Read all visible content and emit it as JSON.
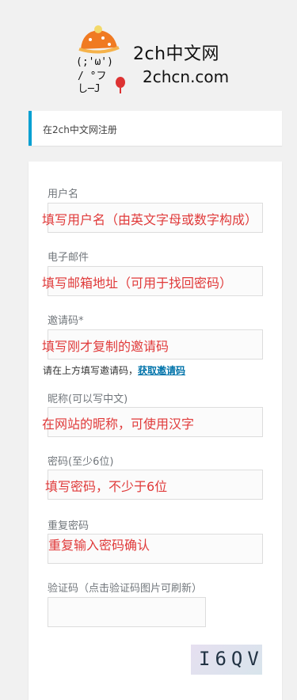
{
  "logo": {
    "title": "2ch中文网",
    "domain": "2chcn.com",
    "face_line1": "(;'ω')",
    "face_line2": "/    °フ",
    "face_line3": "し─J"
  },
  "notice": {
    "text": "在2ch中文网注册"
  },
  "form": {
    "username": {
      "label": "用户名",
      "value": "填写用户名（由英文字母或数字构成）"
    },
    "email": {
      "label": "电子邮件",
      "value": "填写邮箱地址（可用于找回密码）"
    },
    "invite": {
      "label": "邀请码*",
      "value": "填写刚才复制的邀请码",
      "hint": "请在上方填写邀请码，",
      "hint_link": "获取邀请码"
    },
    "nickname": {
      "label": "昵称(可以写中文)",
      "value": "在网站的昵称，可使用汉字"
    },
    "password": {
      "label": "密码(至少6位)",
      "value": "填写密码，不少于6位"
    },
    "password_repeat": {
      "label": "重复密码",
      "value": "重复输入密码确认"
    },
    "captcha": {
      "label": "验证码（点击验证码图片可刷新）",
      "value": "",
      "image_text": "I6QV"
    }
  },
  "colors": {
    "accent": "#00a0d2",
    "link": "#0073aa",
    "annotation": "#e03a3a"
  }
}
